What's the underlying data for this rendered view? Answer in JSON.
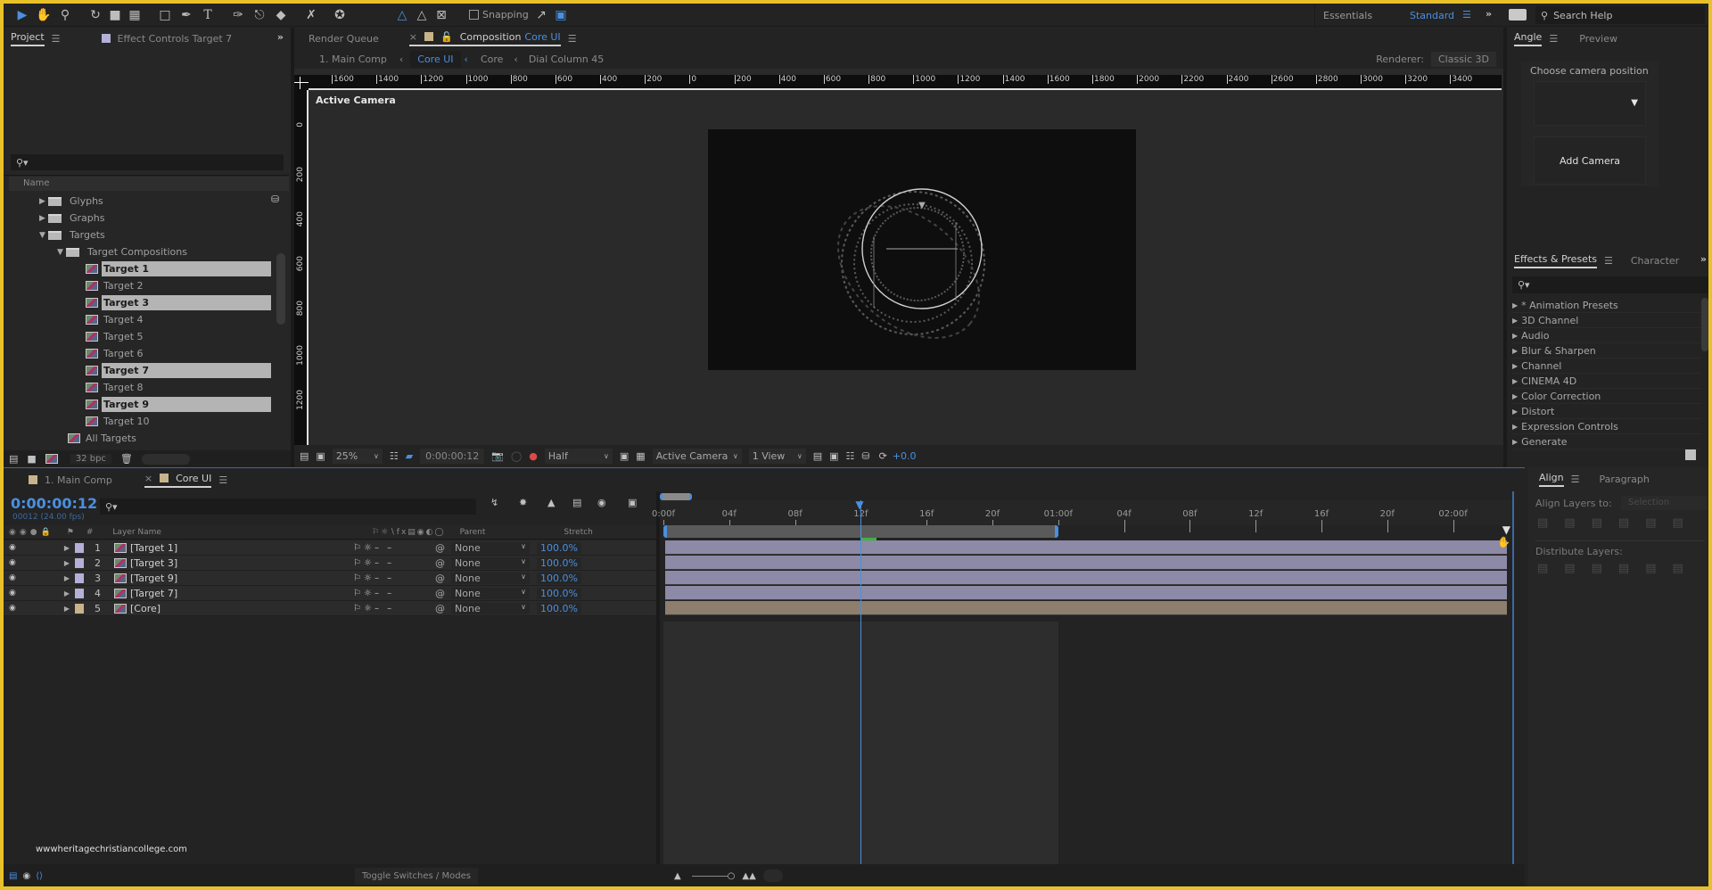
{
  "toolbar": {
    "tools": [
      "selection-tool",
      "hand-tool",
      "zoom-tool",
      "rotate-tool",
      "camera-tool",
      "pan-behind-tool",
      "rectangle-tool",
      "pen-tool",
      "type-tool",
      "brush-tool",
      "clone-stamp-tool",
      "eraser-tool",
      "roto-brush-tool",
      "puppet-pin-tool"
    ],
    "axis_modes": [
      "local-axis",
      "world-axis",
      "view-axis"
    ],
    "snapping_label": "Snapping",
    "workspaces": [
      "Essentials",
      "Standard"
    ],
    "active_workspace": "Standard",
    "search_help_placeholder": "Search Help"
  },
  "project_panel": {
    "tabs": [
      {
        "label": "Project",
        "active": true
      },
      {
        "label": "Effect Controls Target 7",
        "active": false
      }
    ],
    "search_placeholder": "",
    "column_header": "Name",
    "tree": [
      {
        "label": "Glyphs",
        "type": "folder",
        "depth": 0,
        "expanded": false,
        "selected": false
      },
      {
        "label": "Graphs",
        "type": "folder",
        "depth": 0,
        "expanded": false,
        "selected": false
      },
      {
        "label": "Targets",
        "type": "folder",
        "depth": 0,
        "expanded": true,
        "selected": false
      },
      {
        "label": "Target Compositions",
        "type": "folder",
        "depth": 1,
        "expanded": true,
        "selected": false
      },
      {
        "label": "Target 1",
        "type": "comp",
        "depth": 2,
        "selected": true
      },
      {
        "label": "Target 2",
        "type": "comp",
        "depth": 2,
        "selected": false
      },
      {
        "label": "Target 3",
        "type": "comp",
        "depth": 2,
        "selected": true
      },
      {
        "label": "Target 4",
        "type": "comp",
        "depth": 2,
        "selected": false
      },
      {
        "label": "Target 5",
        "type": "comp",
        "depth": 2,
        "selected": false
      },
      {
        "label": "Target 6",
        "type": "comp",
        "depth": 2,
        "selected": false
      },
      {
        "label": "Target 7",
        "type": "comp",
        "depth": 2,
        "selected": true
      },
      {
        "label": "Target 8",
        "type": "comp",
        "depth": 2,
        "selected": false
      },
      {
        "label": "Target 9",
        "type": "comp",
        "depth": 2,
        "selected": true
      },
      {
        "label": "Target 10",
        "type": "comp",
        "depth": 2,
        "selected": false
      },
      {
        "label": "All Targets",
        "type": "comp",
        "depth": 1,
        "selected": false
      }
    ],
    "bit_depth": "32 bpc"
  },
  "composition_panel": {
    "tabs": [
      {
        "label": "Render Queue",
        "active": false
      },
      {
        "label": "Composition",
        "highlight": "Core UI",
        "active": true
      }
    ],
    "breadcrumbs": [
      "1. Main Comp",
      "Core UI",
      "Core",
      "Dial Column 45"
    ],
    "active_breadcrumb": "Core UI",
    "renderer_label": "Renderer:",
    "renderer_value": "Classic 3D",
    "ruler_h": [
      "1600",
      "1400",
      "1200",
      "1000",
      "800",
      "600",
      "400",
      "200",
      "0",
      "200",
      "400",
      "600",
      "800",
      "1000",
      "1200",
      "1400",
      "1600",
      "1800",
      "2000",
      "2200",
      "2400",
      "2600",
      "2800",
      "3000",
      "3200",
      "3400"
    ],
    "ruler_v": [
      "0",
      "200",
      "400",
      "600",
      "800",
      "1000",
      "1200"
    ],
    "view_label": "Active Camera",
    "footer": {
      "zoom": "25%",
      "timecode": "0:00:00:12",
      "resolution": "Half",
      "camera": "Active Camera",
      "views": "1 View",
      "exposure": "+0.0"
    }
  },
  "angle_panel": {
    "tabs": [
      {
        "label": "Angle",
        "active": true
      },
      {
        "label": "Preview",
        "active": false
      }
    ],
    "choose_label": "Choose camera position",
    "add_camera_label": "Add Camera"
  },
  "effects_panel": {
    "tabs": [
      {
        "label": "Effects & Presets",
        "active": true
      },
      {
        "label": "Character",
        "active": false
      }
    ],
    "search_placeholder": "",
    "items": [
      "* Animation Presets",
      "3D Channel",
      "Audio",
      "Blur & Sharpen",
      "Channel",
      "CINEMA 4D",
      "Color Correction",
      "Distort",
      "Expression Controls",
      "Generate"
    ]
  },
  "align_panel": {
    "tabs": [
      {
        "label": "Align",
        "active": true
      },
      {
        "label": "Paragraph",
        "active": false
      }
    ],
    "align_to_label": "Align Layers to:",
    "align_to_value": "Selection",
    "distribute_label": "Distribute Layers:"
  },
  "timeline": {
    "tabs": [
      {
        "label": "1. Main Comp",
        "color": "#c8b48a",
        "active": false
      },
      {
        "label": "Core UI",
        "color": "#c8b48a",
        "active": true
      }
    ],
    "current_time": "0:00:00:12",
    "frame_info": "00012 (24.00 fps)",
    "search_placeholder": "",
    "columns": {
      "label": "#",
      "layer_name": "Layer Name",
      "parent": "Parent",
      "stretch": "Stretch"
    },
    "layers": [
      {
        "index": "1",
        "name": "[Target 1]",
        "label_color": "#b4b0d8",
        "parent": "None",
        "stretch": "100.0%",
        "bar_color": "#8c8aa6"
      },
      {
        "index": "2",
        "name": "[Target 3]",
        "label_color": "#b4b0d8",
        "parent": "None",
        "stretch": "100.0%",
        "bar_color": "#8c8aa6"
      },
      {
        "index": "3",
        "name": "[Target 9]",
        "label_color": "#b4b0d8",
        "parent": "None",
        "stretch": "100.0%",
        "bar_color": "#8c8aa6"
      },
      {
        "index": "4",
        "name": "[Target 7]",
        "label_color": "#b4b0d8",
        "parent": "None",
        "stretch": "100.0%",
        "bar_color": "#8c8aa6"
      },
      {
        "index": "5",
        "name": "[Core]",
        "label_color": "#c8b48a",
        "parent": "None",
        "stretch": "100.0%",
        "bar_color": "#8e7e6e"
      }
    ],
    "ruler_ticks": [
      "0:00f",
      "04f",
      "08f",
      "12f",
      "16f",
      "20f",
      "01:00f",
      "04f",
      "08f",
      "12f",
      "16f",
      "20f",
      "02:00f"
    ],
    "playhead_frame": 12,
    "work_area_end_frame": 24,
    "total_frames": 48,
    "toggle_label": "Toggle Switches / Modes",
    "watermark": "wwwheritagechristiancollege.com"
  },
  "colors": {
    "accent_blue": "#4a8fe0",
    "frame_yellow": "#e8c12a",
    "selected_row": "#b4b4b4"
  }
}
